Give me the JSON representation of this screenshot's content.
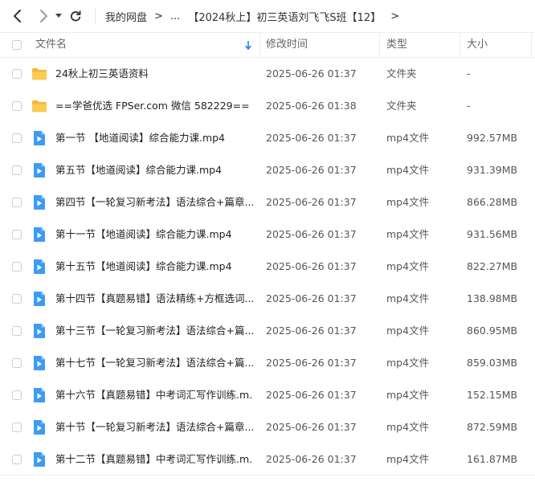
{
  "nav": {
    "back_icon": "chevron-left-icon",
    "forward_icon": "chevron-right-icon",
    "dropdown_icon": "caret-down-icon",
    "refresh_icon": "refresh-icon"
  },
  "breadcrumb": {
    "root": "我的网盘",
    "sep1": ">",
    "ellipsis": "...",
    "current": "【2024秋上】初三英语刘飞飞S班【12】",
    "sep3": ">"
  },
  "columns": {
    "name": "文件名",
    "date": "修改时间",
    "type": "类型",
    "size": "大小"
  },
  "colors": {
    "folder": "#f7c04a",
    "video": "#3d9bf5",
    "sort_arrow": "#2b7de9"
  },
  "files": [
    {
      "name": "24秋上初三英语资料",
      "date": "2025-06-26 01:37",
      "type": "文件夹",
      "size": "-",
      "icon": "folder-icon"
    },
    {
      "name": "==学爸优选 FPSer.com 微信 582229==",
      "date": "2025-06-26 01:38",
      "type": "文件夹",
      "size": "-",
      "icon": "folder-icon"
    },
    {
      "name": "第一节 【地道阅读】综合能力课.mp4",
      "date": "2025-06-26 01:37",
      "type": "mp4文件",
      "size": "992.57MB",
      "icon": "video-file-icon"
    },
    {
      "name": "第五节【地道阅读】综合能力课.mp4",
      "date": "2025-06-26 01:37",
      "type": "mp4文件",
      "size": "931.39MB",
      "icon": "video-file-icon"
    },
    {
      "name": "第四节【一轮复习新考法】语法综合+篇章...",
      "date": "2025-06-26 01:37",
      "type": "mp4文件",
      "size": "866.28MB",
      "icon": "video-file-icon"
    },
    {
      "name": "第十一节【地道阅读】综合能力课.mp4",
      "date": "2025-06-26 01:37",
      "type": "mp4文件",
      "size": "931.56MB",
      "icon": "video-file-icon"
    },
    {
      "name": "第十五节【地道阅读】综合能力课.mp4",
      "date": "2025-06-26 01:37",
      "type": "mp4文件",
      "size": "822.27MB",
      "icon": "video-file-icon"
    },
    {
      "name": "第十四节【真题易错】语法精练+方框选词....",
      "date": "2025-06-26 01:37",
      "type": "mp4文件",
      "size": "138.98MB",
      "icon": "video-file-icon"
    },
    {
      "name": "第十三节【一轮复习新考法】语法综合+篇...",
      "date": "2025-06-26 01:37",
      "type": "mp4文件",
      "size": "860.95MB",
      "icon": "video-file-icon"
    },
    {
      "name": "第十七节【一轮复习新考法】语法综合+篇...",
      "date": "2025-06-26 01:37",
      "type": "mp4文件",
      "size": "859.03MB",
      "icon": "video-file-icon"
    },
    {
      "name": "第十六节【真题易错】中考词汇写作训练.m...",
      "date": "2025-06-26 01:37",
      "type": "mp4文件",
      "size": "152.15MB",
      "icon": "video-file-icon"
    },
    {
      "name": "第十节【一轮复习新考法】语法综合+篇章...",
      "date": "2025-06-26 01:37",
      "type": "mp4文件",
      "size": "872.59MB",
      "icon": "video-file-icon"
    },
    {
      "name": "第十二节【真题易错】中考词汇写作训练.m...",
      "date": "2025-06-26 01:37",
      "type": "mp4文件",
      "size": "161.87MB",
      "icon": "video-file-icon"
    }
  ]
}
